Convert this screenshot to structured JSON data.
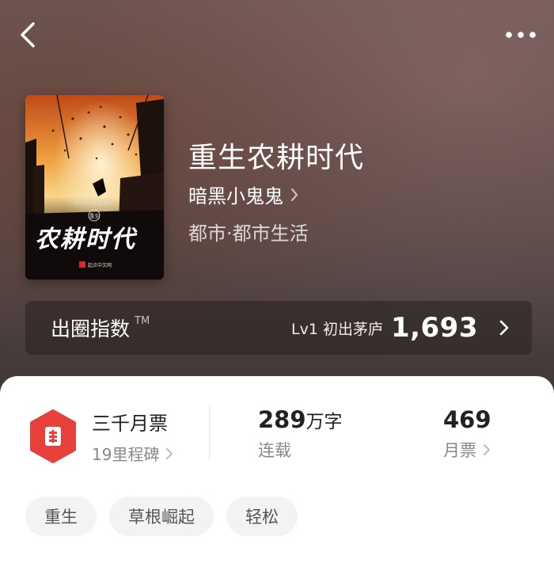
{
  "book": {
    "title": "重生农耕时代",
    "author": "暗黑小鬼鬼",
    "category": "都市·都市生活",
    "cover": {
      "author_line": "暗黑小鬼鬼 著",
      "seal_text": "重生",
      "title_text": "农耕时代",
      "publisher": "起点中文网"
    }
  },
  "index": {
    "label": "出圈指数",
    "tm": "TM",
    "level": "Lv1 初出茅庐",
    "score": "1,693"
  },
  "stats": {
    "ticket_title": "三千月票",
    "milestone": "19里程碑",
    "words_num": "289",
    "words_unit": "万字",
    "status": "连载",
    "monthly_tickets": "469",
    "monthly_label": "月票"
  },
  "tags": [
    "重生",
    "草根崛起",
    "轻松"
  ],
  "icons": {
    "back": "back-arrow-icon",
    "more": "more-dots-icon",
    "badge": "ticket-badge-icon"
  },
  "colors": {
    "badge_red": "#e8413c",
    "hero_bg": "#5a4a49"
  }
}
